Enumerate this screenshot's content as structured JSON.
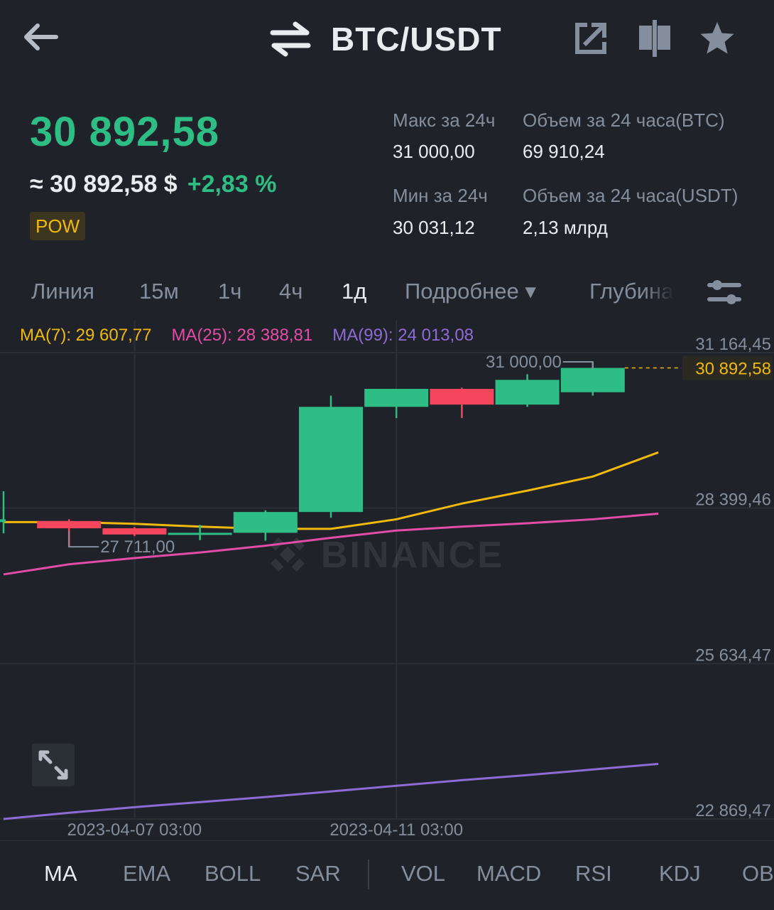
{
  "header": {
    "title": "BTC/USDT",
    "back_icon": "arrow-left-icon",
    "swap_icon": "swap-arrows-icon",
    "share_icon": "share-external-icon",
    "compare_icon": "split-compare-icon",
    "favorite_icon": "star-icon"
  },
  "ticker": {
    "price": "30 892,58",
    "fiat_price": "≈ 30 892,58 $",
    "change": "+2,83 %",
    "badge": "POW",
    "high_label": "Макс за 24ч",
    "high_value": "31 000,00",
    "low_label": "Мин за 24ч",
    "low_value": "30 031,12",
    "vol_base_label": "Объем за 24 часа(BTC)",
    "vol_base_value": "69 910,24",
    "vol_quote_label": "Объем за 24 часа(USDT)",
    "vol_quote_value": "2,13 млрд"
  },
  "tabs": [
    {
      "label": "Линия"
    },
    {
      "label": "15м"
    },
    {
      "label": "1ч"
    },
    {
      "label": "4ч"
    },
    {
      "label": "1д",
      "active": true
    },
    {
      "label": "Подробнее ▾"
    },
    {
      "label": "Глубина"
    }
  ],
  "indicators": {
    "main": [
      "MA",
      "EMA",
      "BOLL",
      "SAR"
    ],
    "sub": [
      "VOL",
      "MACD",
      "RSI",
      "KDJ",
      "OBV"
    ],
    "active": "MA"
  },
  "colors": {
    "up": "#2ebd85",
    "down": "#f6465d",
    "ma7": "#f0b90b",
    "ma25": "#e24da7",
    "ma99": "#8e6cd6",
    "background": "#1f2229"
  },
  "chart_data": {
    "type": "candlestick",
    "ma_legend": {
      "ma7": "MA(7): 29 607,77",
      "ma25": "MA(25): 28 388,81",
      "ma99": "MA(99): 24 013,08"
    },
    "y_ticks": [
      "31 164,45",
      "28 399,46",
      "25 634,47",
      "22 869,47"
    ],
    "y_tick_values": [
      31164.45,
      28399.46,
      25634.47,
      22869.47
    ],
    "x_ticks": [
      "2023-04-07 03:00",
      "2023-04-11 03:00"
    ],
    "current_price_label": "30 892,58",
    "high_marker": "31 000,00",
    "low_marker": "27 711,00",
    "candles": [
      {
        "open": 28150,
        "high": 28700,
        "low": 27950,
        "close": 28200
      },
      {
        "open": 28170,
        "high": 28200,
        "low": 27711,
        "close": 28040
      },
      {
        "open": 28040,
        "high": 28060,
        "low": 27900,
        "close": 27930
      },
      {
        "open": 27930,
        "high": 28100,
        "low": 27830,
        "close": 27960
      },
      {
        "open": 27960,
        "high": 28360,
        "low": 27820,
        "close": 28330
      },
      {
        "open": 28330,
        "high": 30400,
        "low": 28230,
        "close": 30200
      },
      {
        "open": 30200,
        "high": 30520,
        "low": 30000,
        "close": 30520
      },
      {
        "open": 30520,
        "high": 30540,
        "low": 30000,
        "close": 30240
      },
      {
        "open": 30240,
        "high": 30780,
        "low": 30200,
        "close": 30680
      },
      {
        "open": 30460,
        "high": 31000,
        "low": 30400,
        "close": 30892.58
      }
    ],
    "ma7_line": [
      28150,
      28150,
      28120,
      28070,
      28030,
      28030,
      28200,
      28480,
      28710,
      28960,
      29390
    ],
    "ma25_line": [
      27220,
      27400,
      27510,
      27610,
      27730,
      27870,
      28000,
      28070,
      28130,
      28200,
      28300
    ],
    "ma99_line": [
      22870,
      22980,
      23080,
      23170,
      23260,
      23360,
      23460,
      23560,
      23650,
      23750,
      23850
    ]
  }
}
